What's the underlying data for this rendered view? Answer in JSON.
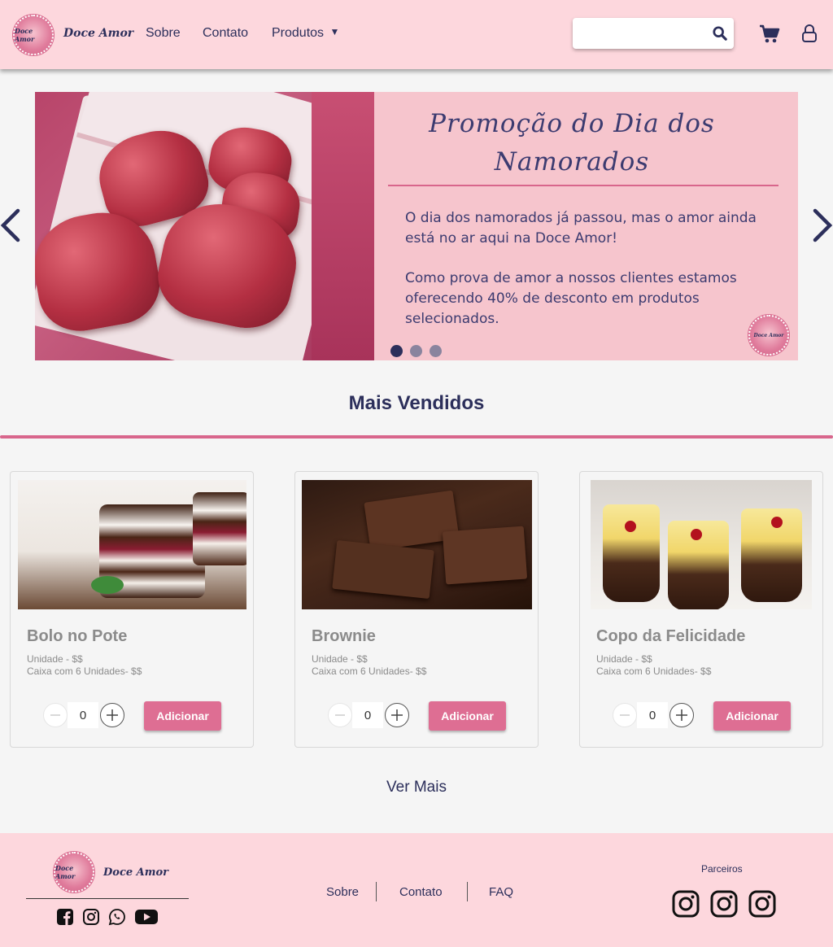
{
  "header": {
    "logo_text": "Doce Amor",
    "brand": "Doce Amor",
    "nav": {
      "about": "Sobre",
      "contact": "Contato",
      "products": "Produtos"
    },
    "search": {
      "placeholder": "",
      "value": ""
    }
  },
  "carousel": {
    "title": "Promoção do Dia dos Namorados",
    "paragraph1": "O dia dos namorados já passou, mas o amor ainda está no ar aqui na Doce Amor!",
    "paragraph2": "Como prova de amor a nossos clientes estamos oferecendo 40% de desconto em produtos selecionados.",
    "seal_text": "Doce Amor",
    "active_slide": 1,
    "slide_count": 3
  },
  "section": {
    "title": "Mais Vendidos"
  },
  "products": [
    {
      "name": "Bolo no Pote",
      "unit_price": "Unidade - $$",
      "box_price": "Caixa com 6 Unidades- $$",
      "qty": "0",
      "add_label": "Adicionar"
    },
    {
      "name": "Brownie",
      "unit_price": "Unidade - $$",
      "box_price": "Caixa com 6 Unidades- $$",
      "qty": "0",
      "add_label": "Adicionar"
    },
    {
      "name": "Copo da Felicidade",
      "unit_price": "Unidade - $$",
      "box_price": "Caixa com 6 Unidades- $$",
      "qty": "0",
      "add_label": "Adicionar"
    }
  ],
  "ver_mais": "Ver Mais",
  "footer": {
    "logo_text": "Doce Amor",
    "brand": "Doce Amor",
    "links": {
      "about": "Sobre",
      "contact": "Contato",
      "faq": "FAQ"
    },
    "partners_label": "Parceiros"
  },
  "colors": {
    "header_bg": "#fdd7dd",
    "navy": "#2c2f5b",
    "accent": "#de6e93",
    "page_bg": "#f5f5f5"
  }
}
